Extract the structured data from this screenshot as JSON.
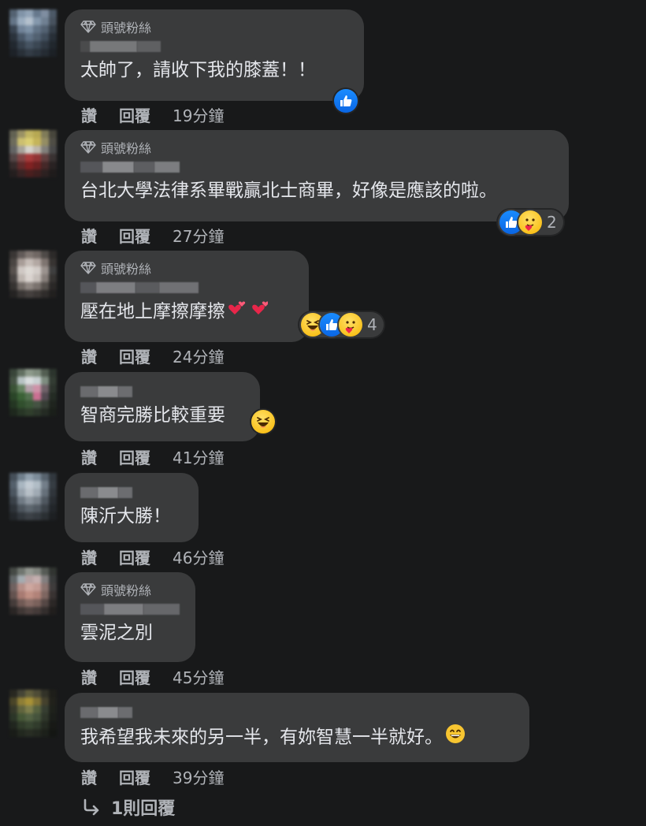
{
  "badge_label": "頭號粉絲",
  "action_like": "讚",
  "action_reply": "回覆",
  "comments": [
    {
      "fan_badge": true,
      "text": "太帥了，請收下我的膝蓋！！",
      "reactions": [
        "like"
      ],
      "reaction_count": "",
      "time": "19分鐘",
      "trailing_emoji": ""
    },
    {
      "fan_badge": true,
      "text": "台北大學法律系畢戰贏北士商畢，好像是應該的啦。",
      "reactions": [
        "like",
        "care"
      ],
      "reaction_count": "2",
      "time": "27分鐘",
      "trailing_emoji": ""
    },
    {
      "fan_badge": true,
      "text": "壓在地上摩擦摩擦",
      "reactions": [
        "haha",
        "like",
        "care"
      ],
      "reaction_count": "4",
      "time": "24分鐘",
      "trailing_emoji": "hearts"
    },
    {
      "fan_badge": false,
      "text": "智商完勝比較重要",
      "reactions": [
        "haha"
      ],
      "reaction_count": "",
      "time": "41分鐘",
      "trailing_emoji": ""
    },
    {
      "fan_badge": false,
      "text": "陳沂大勝！",
      "reactions": [],
      "reaction_count": "",
      "time": "46分鐘",
      "trailing_emoji": ""
    },
    {
      "fan_badge": true,
      "text": "雲泥之別",
      "reactions": [],
      "reaction_count": "",
      "time": "45分鐘",
      "trailing_emoji": ""
    },
    {
      "fan_badge": false,
      "text": "我希望我未來的另一半，有妳智慧一半就好。",
      "reactions": [],
      "reaction_count": "",
      "time": "39分鐘",
      "trailing_emoji": "grin"
    }
  ],
  "more_replies_label": "1則回覆",
  "colors": {
    "background": "#18191a",
    "bubble": "#3a3b3c",
    "text": "#e4e6eb",
    "secondary_text": "#b0b3b8",
    "like_blue": "#1877f2"
  }
}
